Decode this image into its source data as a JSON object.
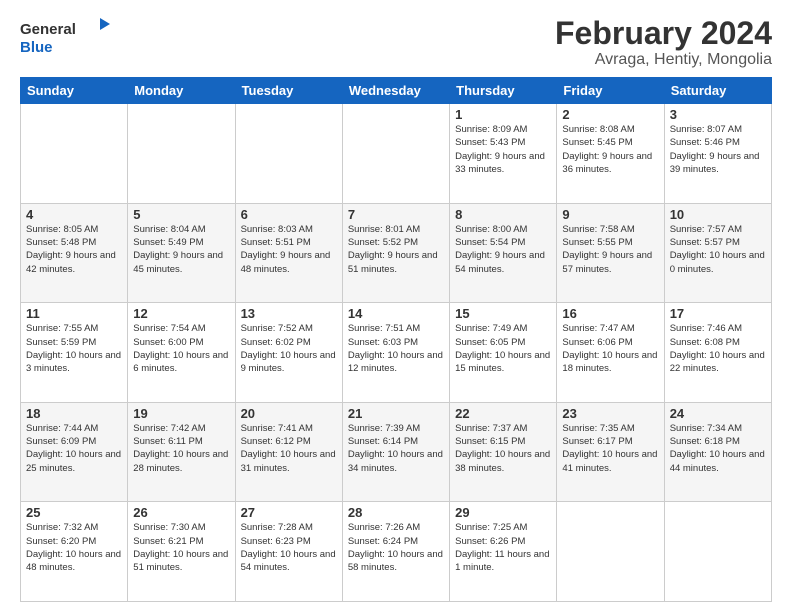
{
  "header": {
    "logo_line1": "General",
    "logo_line2": "Blue",
    "title": "February 2024",
    "subtitle": "Avraga, Hentiy, Mongolia"
  },
  "days_of_week": [
    "Sunday",
    "Monday",
    "Tuesday",
    "Wednesday",
    "Thursday",
    "Friday",
    "Saturday"
  ],
  "weeks": [
    [
      {
        "day": "",
        "info": ""
      },
      {
        "day": "",
        "info": ""
      },
      {
        "day": "",
        "info": ""
      },
      {
        "day": "",
        "info": ""
      },
      {
        "day": "1",
        "info": "Sunrise: 8:09 AM\nSunset: 5:43 PM\nDaylight: 9 hours\nand 33 minutes."
      },
      {
        "day": "2",
        "info": "Sunrise: 8:08 AM\nSunset: 5:45 PM\nDaylight: 9 hours\nand 36 minutes."
      },
      {
        "day": "3",
        "info": "Sunrise: 8:07 AM\nSunset: 5:46 PM\nDaylight: 9 hours\nand 39 minutes."
      }
    ],
    [
      {
        "day": "4",
        "info": "Sunrise: 8:05 AM\nSunset: 5:48 PM\nDaylight: 9 hours\nand 42 minutes."
      },
      {
        "day": "5",
        "info": "Sunrise: 8:04 AM\nSunset: 5:49 PM\nDaylight: 9 hours\nand 45 minutes."
      },
      {
        "day": "6",
        "info": "Sunrise: 8:03 AM\nSunset: 5:51 PM\nDaylight: 9 hours\nand 48 minutes."
      },
      {
        "day": "7",
        "info": "Sunrise: 8:01 AM\nSunset: 5:52 PM\nDaylight: 9 hours\nand 51 minutes."
      },
      {
        "day": "8",
        "info": "Sunrise: 8:00 AM\nSunset: 5:54 PM\nDaylight: 9 hours\nand 54 minutes."
      },
      {
        "day": "9",
        "info": "Sunrise: 7:58 AM\nSunset: 5:55 PM\nDaylight: 9 hours\nand 57 minutes."
      },
      {
        "day": "10",
        "info": "Sunrise: 7:57 AM\nSunset: 5:57 PM\nDaylight: 10 hours\nand 0 minutes."
      }
    ],
    [
      {
        "day": "11",
        "info": "Sunrise: 7:55 AM\nSunset: 5:59 PM\nDaylight: 10 hours\nand 3 minutes."
      },
      {
        "day": "12",
        "info": "Sunrise: 7:54 AM\nSunset: 6:00 PM\nDaylight: 10 hours\nand 6 minutes."
      },
      {
        "day": "13",
        "info": "Sunrise: 7:52 AM\nSunset: 6:02 PM\nDaylight: 10 hours\nand 9 minutes."
      },
      {
        "day": "14",
        "info": "Sunrise: 7:51 AM\nSunset: 6:03 PM\nDaylight: 10 hours\nand 12 minutes."
      },
      {
        "day": "15",
        "info": "Sunrise: 7:49 AM\nSunset: 6:05 PM\nDaylight: 10 hours\nand 15 minutes."
      },
      {
        "day": "16",
        "info": "Sunrise: 7:47 AM\nSunset: 6:06 PM\nDaylight: 10 hours\nand 18 minutes."
      },
      {
        "day": "17",
        "info": "Sunrise: 7:46 AM\nSunset: 6:08 PM\nDaylight: 10 hours\nand 22 minutes."
      }
    ],
    [
      {
        "day": "18",
        "info": "Sunrise: 7:44 AM\nSunset: 6:09 PM\nDaylight: 10 hours\nand 25 minutes."
      },
      {
        "day": "19",
        "info": "Sunrise: 7:42 AM\nSunset: 6:11 PM\nDaylight: 10 hours\nand 28 minutes."
      },
      {
        "day": "20",
        "info": "Sunrise: 7:41 AM\nSunset: 6:12 PM\nDaylight: 10 hours\nand 31 minutes."
      },
      {
        "day": "21",
        "info": "Sunrise: 7:39 AM\nSunset: 6:14 PM\nDaylight: 10 hours\nand 34 minutes."
      },
      {
        "day": "22",
        "info": "Sunrise: 7:37 AM\nSunset: 6:15 PM\nDaylight: 10 hours\nand 38 minutes."
      },
      {
        "day": "23",
        "info": "Sunrise: 7:35 AM\nSunset: 6:17 PM\nDaylight: 10 hours\nand 41 minutes."
      },
      {
        "day": "24",
        "info": "Sunrise: 7:34 AM\nSunset: 6:18 PM\nDaylight: 10 hours\nand 44 minutes."
      }
    ],
    [
      {
        "day": "25",
        "info": "Sunrise: 7:32 AM\nSunset: 6:20 PM\nDaylight: 10 hours\nand 48 minutes."
      },
      {
        "day": "26",
        "info": "Sunrise: 7:30 AM\nSunset: 6:21 PM\nDaylight: 10 hours\nand 51 minutes."
      },
      {
        "day": "27",
        "info": "Sunrise: 7:28 AM\nSunset: 6:23 PM\nDaylight: 10 hours\nand 54 minutes."
      },
      {
        "day": "28",
        "info": "Sunrise: 7:26 AM\nSunset: 6:24 PM\nDaylight: 10 hours\nand 58 minutes."
      },
      {
        "day": "29",
        "info": "Sunrise: 7:25 AM\nSunset: 6:26 PM\nDaylight: 11 hours\nand 1 minute."
      },
      {
        "day": "",
        "info": ""
      },
      {
        "day": "",
        "info": ""
      }
    ]
  ]
}
